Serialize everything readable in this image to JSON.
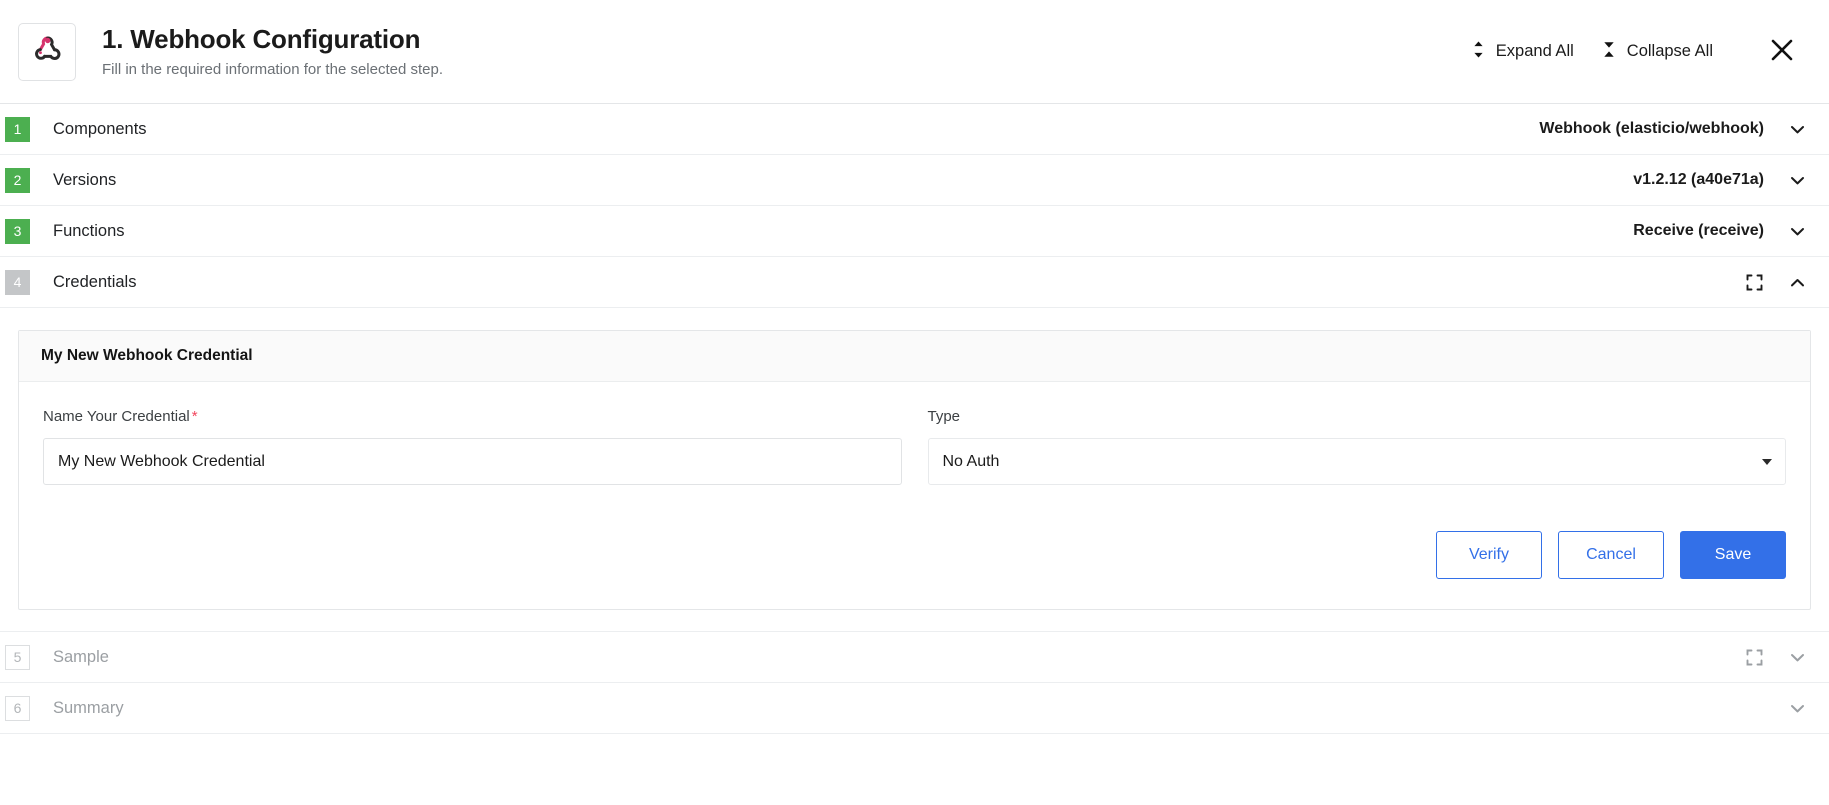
{
  "header": {
    "logo_icon": "webhook-logo-icon",
    "title": "1. Webhook Configuration",
    "subtitle": "Fill in the required information for the selected step.",
    "expand_all_label": "Expand All",
    "collapse_all_label": "Collapse All",
    "expand_all_icon": "expand-vertical-icon",
    "collapse_all_icon": "collapse-vertical-icon",
    "close_icon": "close-icon"
  },
  "colors": {
    "badge_done": "#4caf50",
    "badge_active": "#c4c6c8",
    "badge_muted_text": "#b3b6b9",
    "primary_blue": "#3370e8",
    "required_red": "#f2445c",
    "logo_pink": "#d6336c"
  },
  "steps": [
    {
      "number": "1",
      "label": "Components",
      "value": "Webhook (elasticio/webhook)",
      "state": "done",
      "chevron": "chevron-down-icon",
      "has_expand_icon": false
    },
    {
      "number": "2",
      "label": "Versions",
      "value": "v1.2.12 (a40e71a)",
      "state": "done",
      "chevron": "chevron-down-icon",
      "has_expand_icon": false
    },
    {
      "number": "3",
      "label": "Functions",
      "value": "Receive (receive)",
      "state": "done",
      "chevron": "chevron-down-icon",
      "has_expand_icon": false
    },
    {
      "number": "4",
      "label": "Credentials",
      "value": "",
      "state": "active",
      "chevron": "chevron-up-icon",
      "has_expand_icon": true
    },
    {
      "number": "5",
      "label": "Sample",
      "value": "",
      "state": "muted",
      "chevron": "chevron-down-icon",
      "has_expand_icon": true
    },
    {
      "number": "6",
      "label": "Summary",
      "value": "",
      "state": "muted",
      "chevron": "chevron-down-icon",
      "has_expand_icon": false
    }
  ],
  "credential_panel": {
    "title": "My New Webhook Credential",
    "name_field": {
      "label": "Name Your Credential",
      "required_marker": "*",
      "value": "My New Webhook Credential",
      "placeholder": "Name Your Credential"
    },
    "type_field": {
      "label": "Type",
      "selected": "No Auth",
      "dropdown_icon": "caret-down-icon"
    },
    "buttons": {
      "verify": "Verify",
      "cancel": "Cancel",
      "save": "Save"
    }
  }
}
